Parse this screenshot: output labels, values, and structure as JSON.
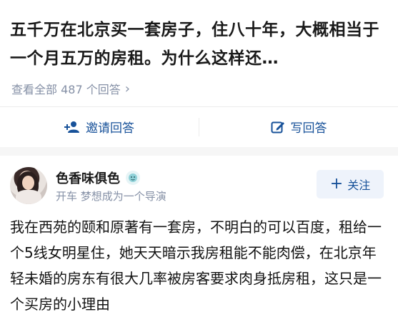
{
  "question": {
    "title": "五千万在北京买一套房子，住八十年，大概相当于一个月五万的房租。为什么这样还…",
    "view_all": "查看全部 487 个回答"
  },
  "actions": {
    "invite": "邀请回答",
    "write": "写回答"
  },
  "answer": {
    "author_name": "色香味俱色",
    "author_bio": "开车 梦想成为一个导演",
    "follow_label": "关注",
    "text": "我在西苑的颐和原著有一套房，不明白的可以百度，租给一个5线女明星住，她天天暗示我房租能不能肉偿，在北京年轻未婚的房东有很大几率被房客要求肉身抵房租，这只是一个买房的小理由"
  },
  "colors": {
    "link_blue": "#175199",
    "muted": "#8590a6",
    "follow_bg": "#eef3fb"
  }
}
